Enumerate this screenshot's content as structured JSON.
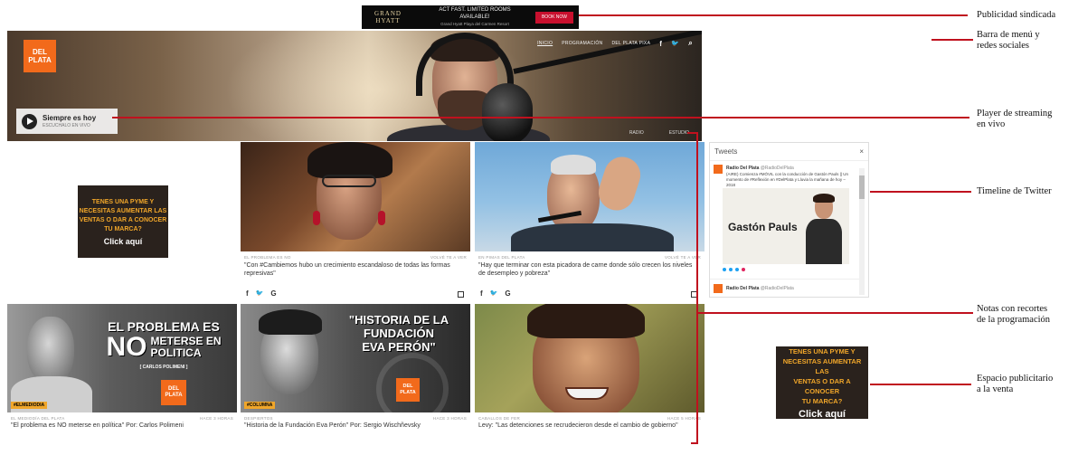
{
  "top_ad": {
    "brand": "GRAND HYATT",
    "promo_line1": "ACT FAST. LIMITED ROOMS",
    "promo_line2": "AVAILABLE!",
    "promo_line3": "Grand Hyatt Playa del Carmen Resort",
    "cta": "BOOK NOW"
  },
  "header": {
    "logo_line1": "DEL",
    "logo_line2": "PLATA",
    "nav_items": [
      "INICIO",
      "PROGRAMACIÓN",
      "DEL PLATA PIXA"
    ],
    "social": {
      "facebook": "f",
      "twitter": "🐦",
      "search": "⌕"
    },
    "hero_labels": [
      "RADIO",
      "ESTUDIO"
    ]
  },
  "player": {
    "title": "Siempre es hoy",
    "subtitle": "ESCUCHALO EN VIVO"
  },
  "ads": {
    "pyme_lines": [
      "TENES UNA PYME Y",
      "NECESITAS AUMENTAR LAS",
      "VENTAS O DAR A CONOCER",
      "TU MARCA?"
    ],
    "pyme_cta": "Click aquí"
  },
  "notes": [
    {
      "meta_left": "EL PROBLEMA ES NO",
      "meta_right": "VOLVÉ TE A VER",
      "caption": "\"Con #Cambiemos hubo un crecimiento escandaloso de todas las formas represivas\""
    },
    {
      "meta_left": "EN PIMAS DEL PLATA",
      "meta_right": "VOLVÉ TE A VER",
      "caption": "\"Hay que terminar con esta picadora de carne donde sólo crecen los niveles de desempleo y pobreza\""
    },
    {
      "meta_left": "EL MEDIODÍA DEL PLATA",
      "meta_right": "HACE 3 HORAS",
      "caption": "\"El problema es NO meterse en política\" Por: Carlos Polimeni",
      "overlay_lines": [
        "EL PROBLEMA ES",
        "NO",
        "METERSE EN",
        "POLITICA"
      ],
      "byline": "[ CARLOS POLIMENI ]",
      "tag": "#ELMEDIODIA"
    },
    {
      "meta_left": "DESPIERTOS",
      "meta_right": "HACE 3 HORAS",
      "caption": "\"Historia de la Fundación Eva Perón\" Por: Sergio Wischñevsky",
      "overlay_lines": [
        "\"HISTORIA DE LA",
        "FUNDACIÓN",
        "EVA PERÓN\""
      ],
      "tag": "#COLUMNA"
    },
    {
      "meta_left": "CABALLOS DE FER",
      "meta_right": "HACE 5 HORAS",
      "caption": "Levy: \"Las detenciones se recrudecieron desde el cambio de gobierno\""
    }
  ],
  "share_icons": [
    "f",
    "🐦",
    "G"
  ],
  "twitter": {
    "header": "Tweets",
    "close": "×",
    "account": "Radio Del Plata",
    "handle": "@RadioDelPlata",
    "tweet1": "(AIRE) Comienza #MÓVIL con la conducción de Gastón Pauls || Un momento de #Reflexión en #DelPlata y Lluvia la mañana de hoy – 2018",
    "card_name": "Gastón Pauls",
    "tweet2_account": "Radio Del Plata",
    "tweet2_handle": "@RadioDelPlata"
  },
  "annotations": {
    "ad": "Publicidad sindicada",
    "menu_line1": "Barra de menú y",
    "menu_line2": "redes sociales",
    "player_line1": "Player de streaming",
    "player_line2": "en vivo",
    "twitter": "Timeline de Twitter",
    "notes_line1": "Notas con recortes",
    "notes_line2": "de la programación",
    "space_line1": "Espacio publicitario",
    "space_line2": "a la venta"
  },
  "colors": {
    "brand_orange": "#f26a1b",
    "annotation_red": "#c0111e",
    "ad_yellow": "#f0a62a"
  }
}
